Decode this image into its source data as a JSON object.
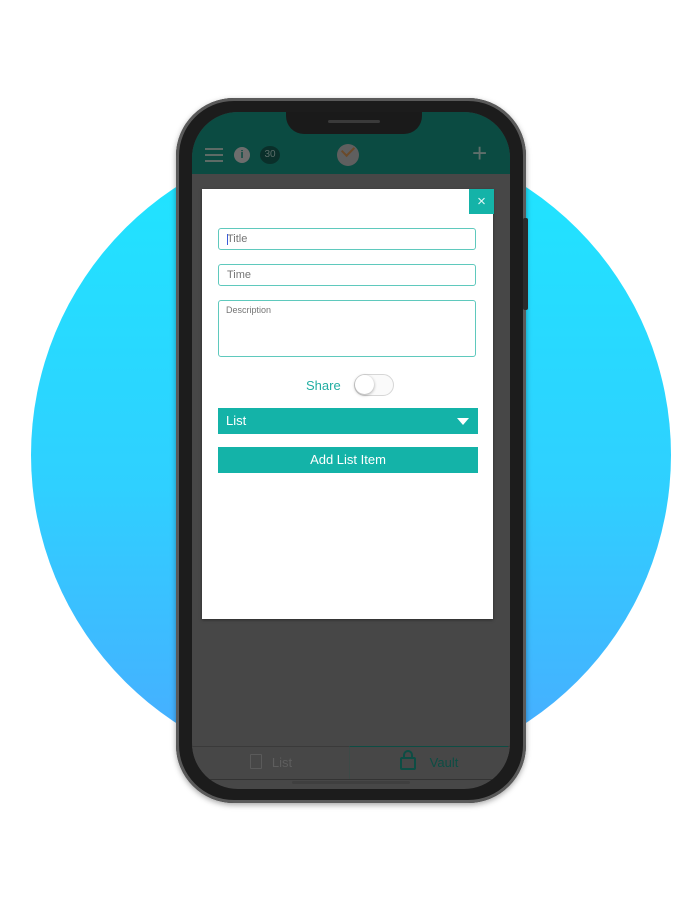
{
  "theme": {
    "accent": "#14b3a8",
    "topbar": "#0b4b42",
    "backdrop": "#474747",
    "circle_top": "#1ee6ff",
    "circle_bottom": "#4aa9ff"
  },
  "topbar": {
    "menu_icon": "list-icon",
    "info_icon": "info-icon",
    "info_glyph": "i",
    "badge_count": "30",
    "logo_icon": "check-clock-icon",
    "add_icon": "plus-icon",
    "add_glyph": "+"
  },
  "modal": {
    "close_glyph": "×",
    "title_field": {
      "placeholder": "Title",
      "value": ""
    },
    "time_field": {
      "placeholder": "Time",
      "value": ""
    },
    "description_field": {
      "placeholder": "Description",
      "value": ""
    },
    "share": {
      "label": "Share",
      "enabled": false
    },
    "list_select": {
      "selected": "List"
    },
    "add_button_label": "Add List Item"
  },
  "tabbar": {
    "tabs": [
      {
        "label": "List",
        "icon": "document-icon",
        "active": false
      },
      {
        "label": "Vault",
        "icon": "lock-icon",
        "active": true
      }
    ]
  }
}
